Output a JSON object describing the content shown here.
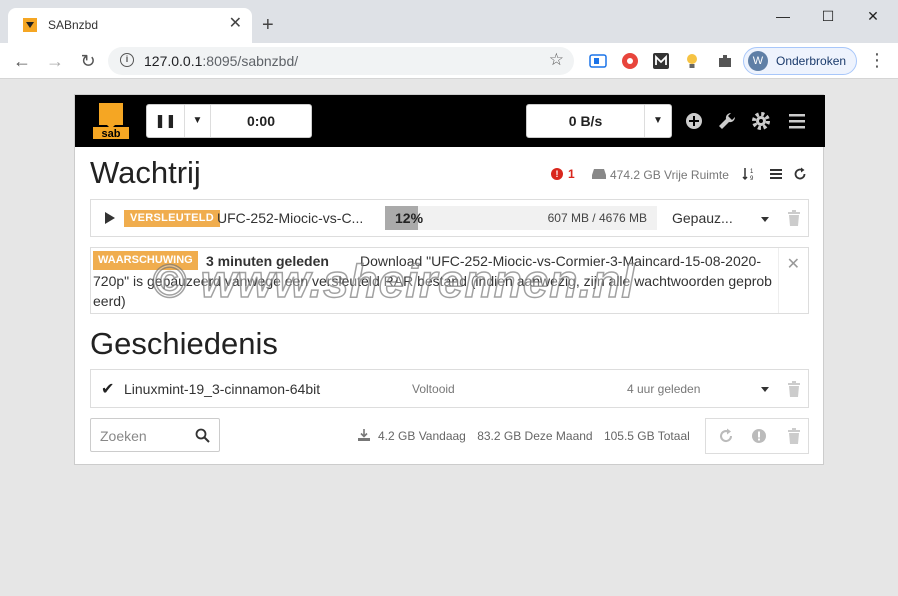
{
  "browser": {
    "tab_title": "SABnzbd",
    "url_host": "127.0.0.1",
    "url_path": ":8095/sabnzbd/",
    "profile_initial": "W",
    "profile_label": "Onderbroken",
    "accent": "#1a73e8"
  },
  "header": {
    "pause_icon": "pause-icon",
    "timer": "0:00",
    "speed": "0 B/s",
    "icons": [
      "add-icon",
      "wrench-icon",
      "gear-icon",
      "menu-icon"
    ],
    "logo_color": "#f5a623"
  },
  "queue": {
    "title": "Wachtrij",
    "warning_count": "1",
    "free_space": "474.2 GB Vrije Ruimte",
    "items": [
      {
        "badge": "VERSLEUTELD",
        "name": "UFC-252-Miocic-vs-C...",
        "progress_pct": "12%",
        "progress": 0.12,
        "size": "607 MB / 4676 MB",
        "status": "Gepauz..."
      }
    ]
  },
  "warning": {
    "badge": "WAARSCHUWING",
    "time": "3 minuten geleden",
    "line1": "Download \"UFC-252-Miocic-vs-Cormier-3-Maincard-15-08-2020-",
    "line2": "720p\" is gepauzeerd vanwege een versleuteld RAR bestand (indien aanwezig, zijn alle wachtwoorden geprob",
    "line3": "eerd)"
  },
  "history": {
    "title": "Geschiedenis",
    "items": [
      {
        "name": "Linuxmint-19_3-cinnamon-64bit",
        "status": "Voltooid",
        "time": "4 uur geleden"
      }
    ]
  },
  "footer": {
    "search_placeholder": "Zoeken",
    "today": "4.2 GB Vandaag",
    "month": "83.2 GB Deze Maand",
    "total": "105.5 GB Totaal"
  },
  "watermark": "© www.sheirennen.nl"
}
